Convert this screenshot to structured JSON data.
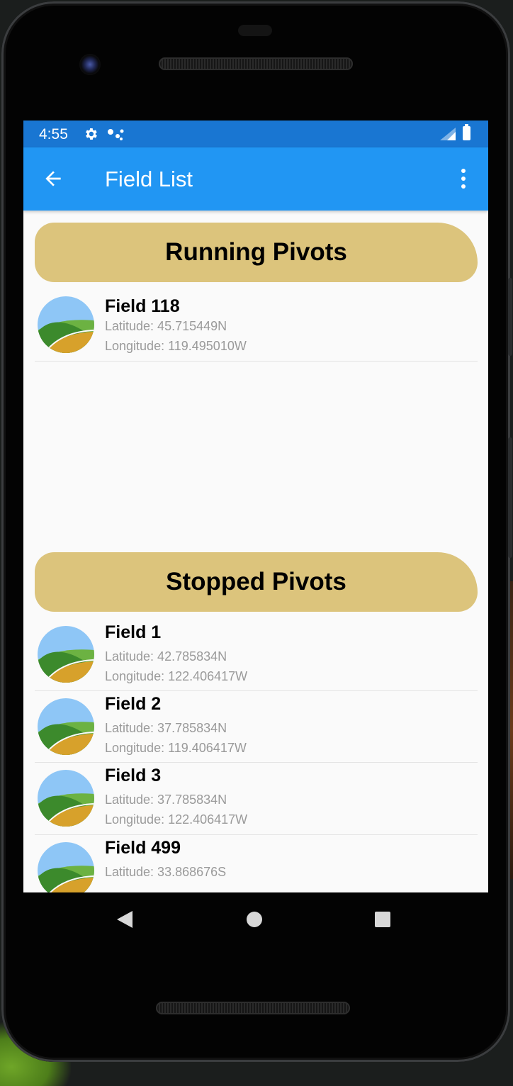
{
  "status_bar": {
    "time": "4:55"
  },
  "app_bar": {
    "title": "Field List"
  },
  "running_section": {
    "title": "Running Pivots",
    "fields": [
      {
        "name": "Field 118",
        "latitude": "Latitude: 45.715449N",
        "longitude": "Longitude: 119.495010W"
      }
    ]
  },
  "stopped_section": {
    "title": "Stopped Pivots",
    "fields": [
      {
        "name": "Field 1",
        "latitude": "Latitude: 42.785834N",
        "longitude": "Longitude: 122.406417W"
      },
      {
        "name": "Field 2",
        "latitude": "Latitude: 37.785834N",
        "longitude": "Longitude: 119.406417W"
      },
      {
        "name": "Field 3",
        "latitude": "Latitude: 37.785834N",
        "longitude": "Longitude: 122.406417W"
      },
      {
        "name": "Field 499",
        "latitude": "Latitude: 33.868676S"
      }
    ]
  },
  "icons": {
    "status": [
      "gear-icon",
      "assistant-dots-icon",
      "cell-signal-icon",
      "battery-icon"
    ],
    "app_bar": [
      "back-arrow-icon",
      "more-vert-icon"
    ],
    "row": "field-landscape-icon",
    "nav": [
      "back-triangle-icon",
      "home-circle-icon",
      "recents-square-icon"
    ]
  },
  "colors": {
    "status_bar": "#1976d2",
    "app_bar": "#2196f3",
    "section_header": "#dcc47c",
    "secondary_text": "#9a9a9a"
  }
}
